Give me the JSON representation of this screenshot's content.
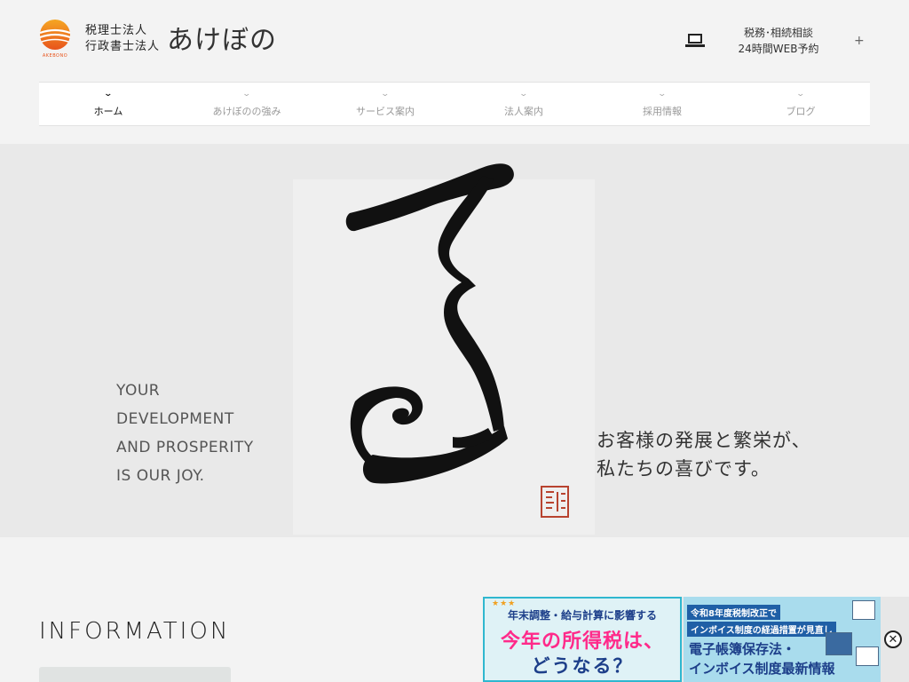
{
  "header": {
    "logo_sub_line1": "税理士法人",
    "logo_sub_line2": "行政書士法人",
    "logo_name": "あけぼの",
    "logo_mark_text": "AKEBONO",
    "contact_line1": "税務･相続相談",
    "contact_line2": "24時間WEB予約",
    "contact_plus": "+"
  },
  "nav": {
    "items": [
      {
        "label": "ホーム",
        "active": true
      },
      {
        "label": "あけぼのの強み",
        "active": false
      },
      {
        "label": "サービス案内",
        "active": false
      },
      {
        "label": "法人案内",
        "active": false
      },
      {
        "label": "採用情報",
        "active": false
      },
      {
        "label": "ブログ",
        "active": false
      }
    ],
    "chevron": "⌄"
  },
  "hero": {
    "en_line1": "YOUR",
    "en_line2": "DEVELOPMENT",
    "en_line3": "AND PROSPERITY",
    "en_line4": "IS OUR JOY.",
    "jp_line1": "お客様の発展と繁栄が、",
    "jp_line2": "私たちの喜びです。"
  },
  "information": {
    "title": "INFORMATION"
  },
  "banner": {
    "a_stars": "★★★",
    "a_line1": "年末調整・給与計算に影響する",
    "a_line2": "今年の所得税は、",
    "a_line3": "どうなる？",
    "b_tag1": "令和8年度税制改正で",
    "b_tag2": "インボイス制度の経過措置が見直し",
    "b_big1": "電子帳簿保存法・",
    "b_big2": "インボイス制度最新情報",
    "close": "✕"
  },
  "colors": {
    "accent_orange": "#f08a1c",
    "banner_blue": "#1d3f8a",
    "banner_pink": "#ff2a8a"
  }
}
